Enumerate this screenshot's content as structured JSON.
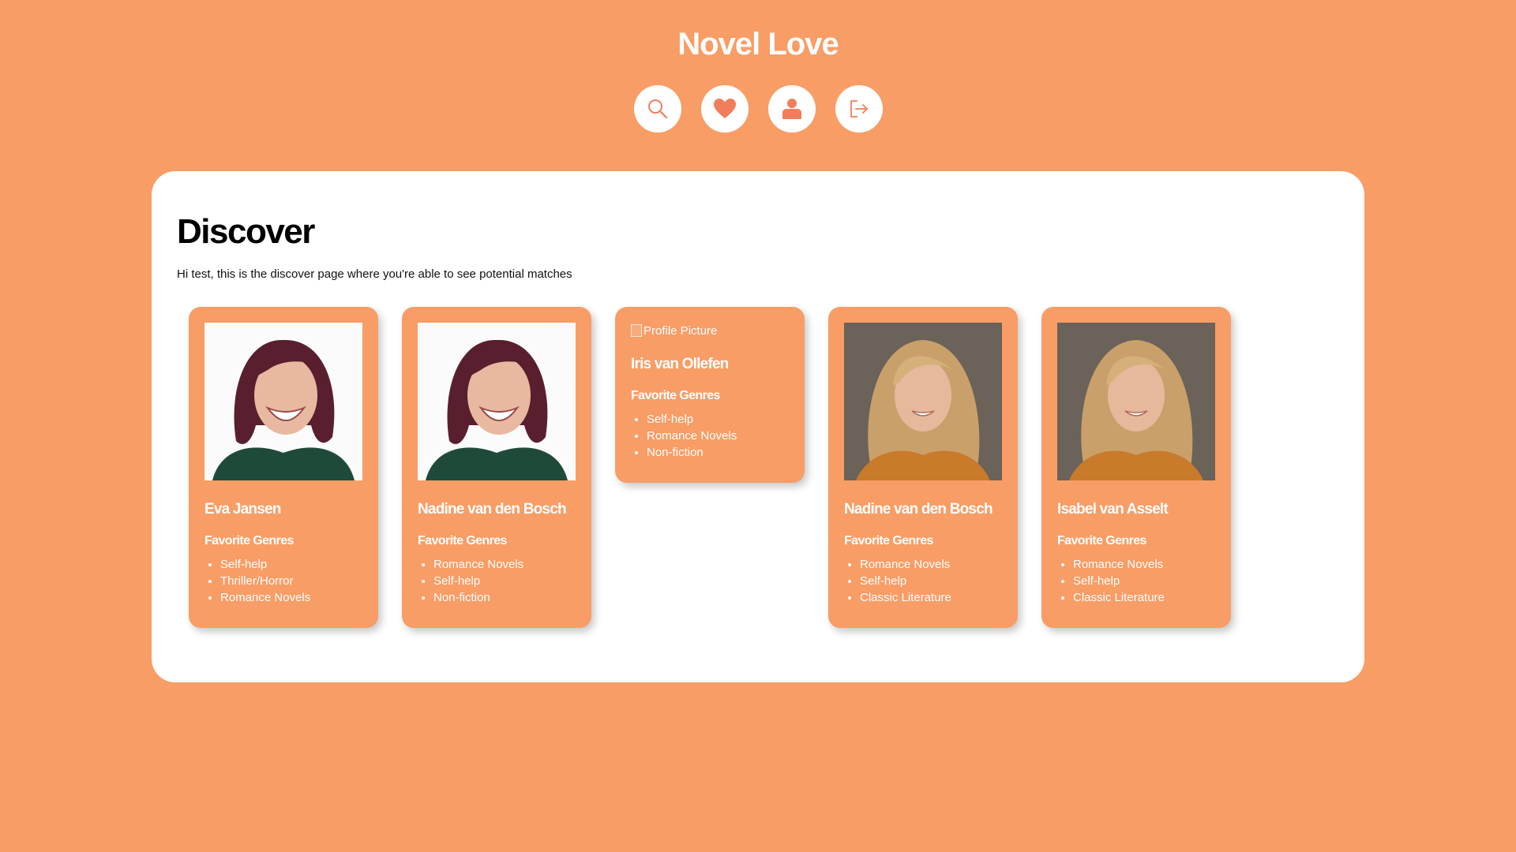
{
  "app": {
    "title": "Novel Love"
  },
  "nav": [
    {
      "name": "search-nav-button",
      "icon": "search-icon"
    },
    {
      "name": "favorites-nav-button",
      "icon": "heart-icon"
    },
    {
      "name": "profile-nav-button",
      "icon": "user-icon"
    },
    {
      "name": "logout-nav-button",
      "icon": "logout-icon"
    }
  ],
  "page": {
    "title": "Discover",
    "intro": "Hi test, this is the discover page where you're able to see potential matches"
  },
  "genres_heading": "Favorite Genres",
  "profiles": [
    {
      "name": "Eva Jansen",
      "photo": "woman-dark-hair-photo",
      "genres": [
        "Self-help",
        "Thriller/Horror",
        "Romance Novels"
      ]
    },
    {
      "name": "Nadine van den Bosch",
      "photo": "woman-dark-hair-photo",
      "genres": [
        "Romance Novels",
        "Self-help",
        "Non-fiction"
      ]
    },
    {
      "name": "Iris van Ollefen",
      "photo": null,
      "photo_alt": "Profile Picture",
      "genres": [
        "Self-help",
        "Romance Novels",
        "Non-fiction"
      ]
    },
    {
      "name": "Nadine van den Bosch",
      "photo": "woman-blonde-hair-photo",
      "genres": [
        "Romance Novels",
        "Self-help",
        "Classic Literature"
      ]
    },
    {
      "name": "Isabel van Asselt",
      "photo": "woman-blonde-hair-photo",
      "genres": [
        "Romance Novels",
        "Self-help",
        "Classic Literature"
      ]
    }
  ],
  "colors": {
    "background": "#F89D66",
    "panel": "#FFFFFF",
    "icon": "#F07E5A"
  }
}
